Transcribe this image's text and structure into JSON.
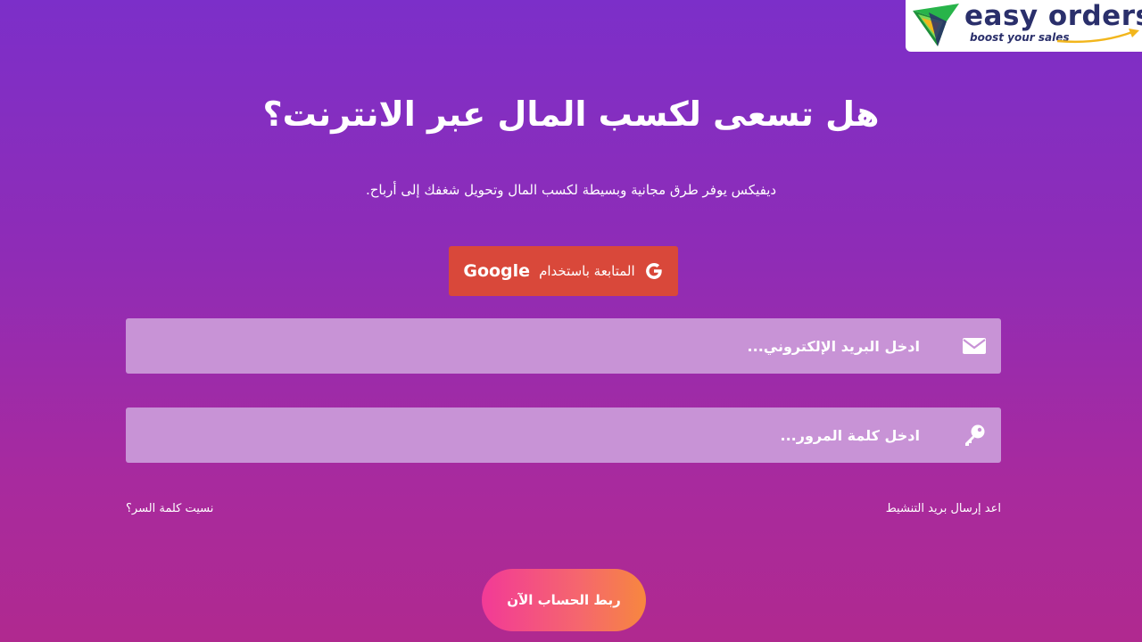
{
  "brand": {
    "name": "easy orders",
    "tagline": "boost your sales"
  },
  "hero": {
    "title": "هل تسعى لكسب المال عبر الانترنت؟",
    "subtitle": "ديفيكس يوفر طرق مجانية وبسيطة لكسب المال وتحويل شغفك إلى أرباح."
  },
  "google_button": {
    "label": "المتابعة باستخدام",
    "brand": "Google",
    "icon": "google-g-icon"
  },
  "form": {
    "email": {
      "placeholder": "ادخل البريد الإلكتروني...",
      "value": "",
      "icon": "envelope-icon"
    },
    "password": {
      "placeholder": "ادخل كلمة المرور...",
      "value": "",
      "icon": "key-icon"
    },
    "forgot_password": "نسيت كلمة السر؟",
    "resend_activation": "اعد إرسال بريد التنشيط",
    "submit_label": "ربط الحساب الآن"
  },
  "colors": {
    "bg_top": "#7c2fc9",
    "bg_bottom": "#b0298f",
    "google_red": "#d9483a",
    "field_bg": "#c893d6",
    "submit_start": "#f23a97",
    "submit_end": "#f7873f",
    "logo_navy": "#2a2f6b",
    "logo_green": "#28b44a"
  }
}
